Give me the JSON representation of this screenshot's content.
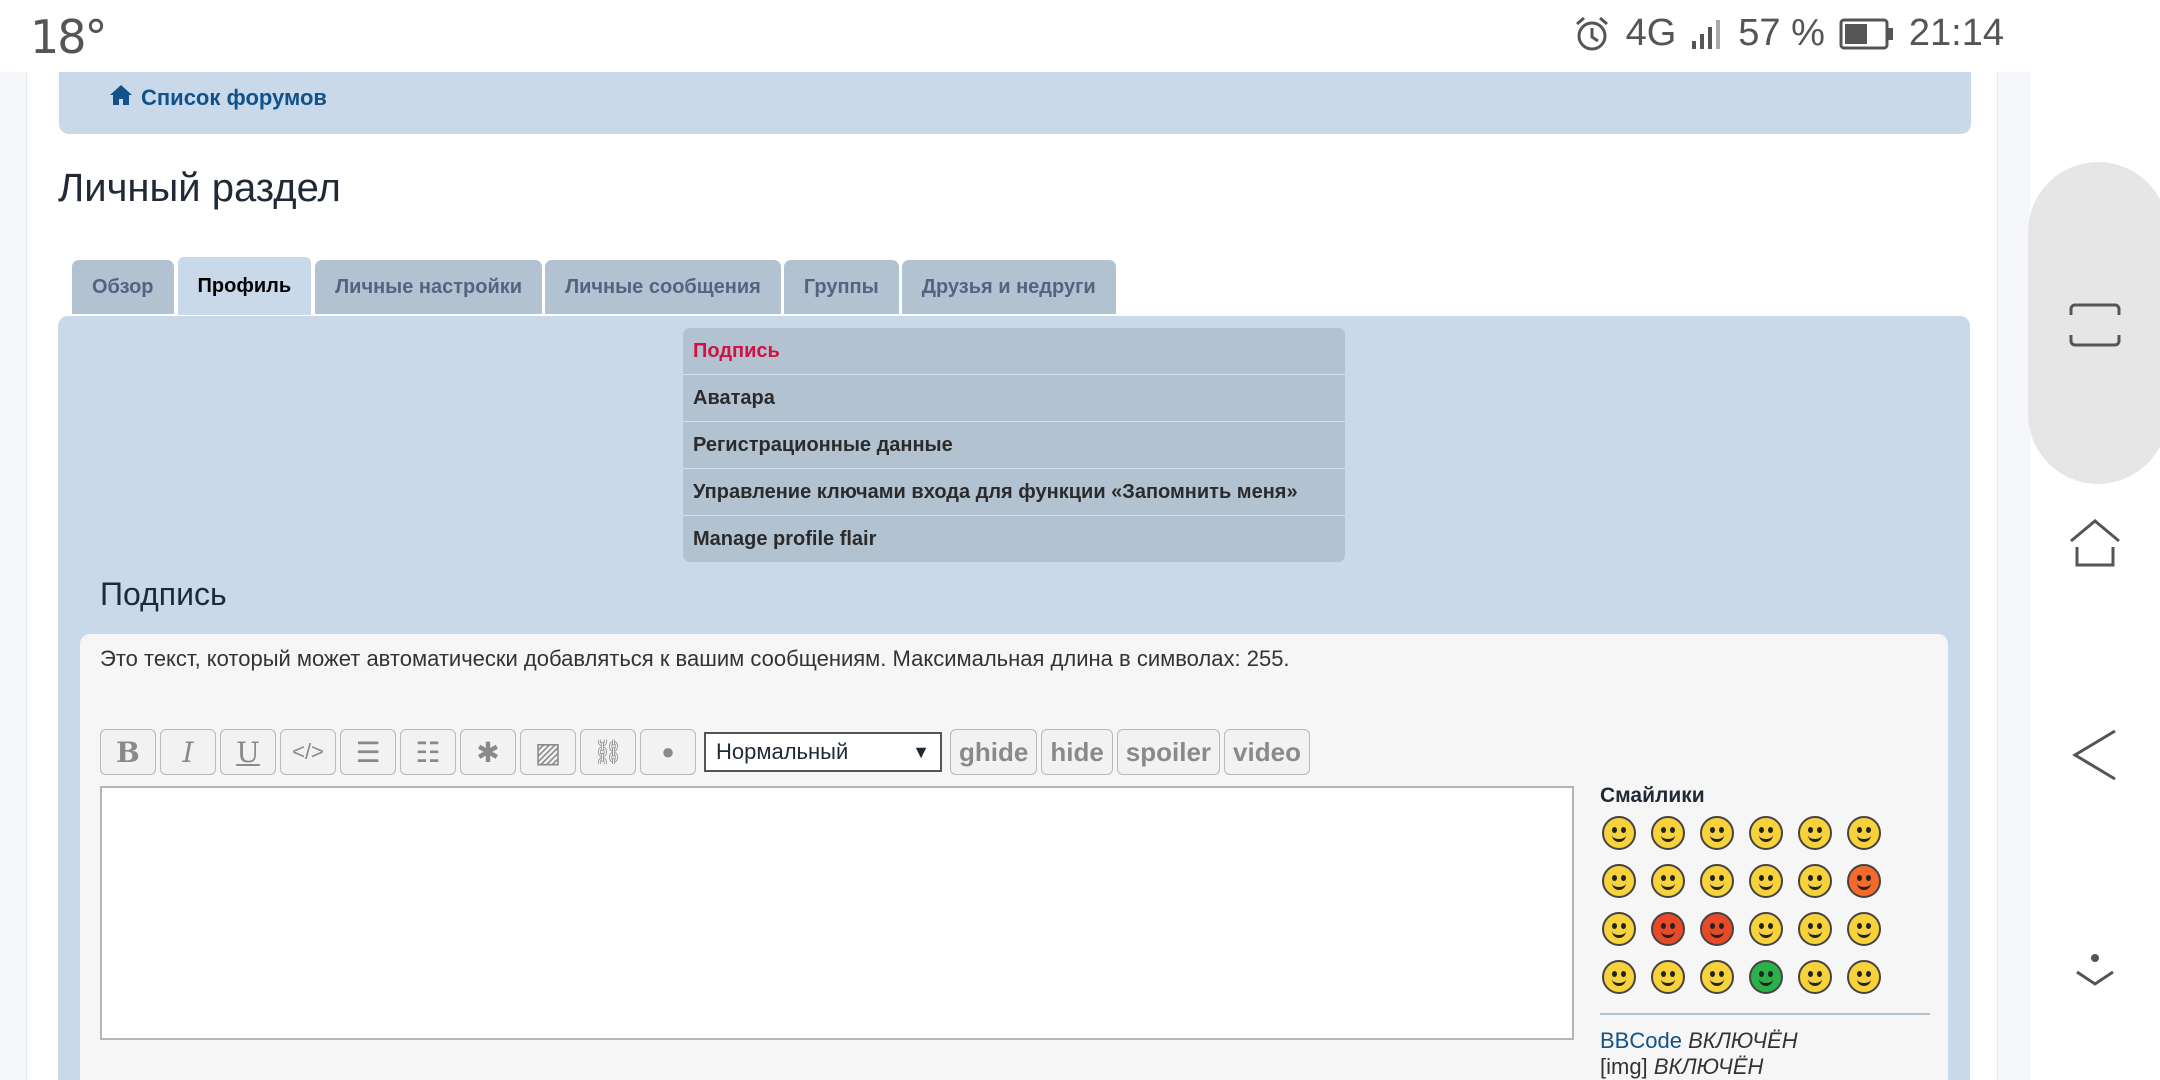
{
  "status_bar": {
    "temperature": "18°",
    "network": "4G",
    "battery": "57 %",
    "time": "21:14"
  },
  "forum_nav": {
    "link_label": "Список форумов"
  },
  "page_title": "Личный раздел",
  "tabs": [
    {
      "label": "Обзор",
      "active": false
    },
    {
      "label": "Профиль",
      "active": true
    },
    {
      "label": "Личные настройки",
      "active": false
    },
    {
      "label": "Личные сообщения",
      "active": false
    },
    {
      "label": "Группы",
      "active": false
    },
    {
      "label": "Друзья и недруги",
      "active": false
    }
  ],
  "submenu": [
    {
      "label": "Подпись",
      "active": true
    },
    {
      "label": "Аватара",
      "active": false
    },
    {
      "label": "Регистрационные данные",
      "active": false
    },
    {
      "label": "Управление ключами входа для функции «Запомнить меня»",
      "active": false
    },
    {
      "label": "Manage profile flair",
      "active": false
    }
  ],
  "section": {
    "title": "Подпись",
    "description": "Это текст, который может автоматически добавляться к вашим сообщениям. Максимальная длина в символах: 255."
  },
  "editor": {
    "icon_buttons": [
      {
        "name": "bold-button",
        "glyph": "B"
      },
      {
        "name": "italic-button",
        "glyph": "I"
      },
      {
        "name": "underline-button",
        "glyph": "U"
      },
      {
        "name": "code-button",
        "glyph": "</>"
      },
      {
        "name": "list-button",
        "glyph": "☰"
      },
      {
        "name": "numbered-list-button",
        "glyph": "☷"
      },
      {
        "name": "list-item-button",
        "glyph": "✱"
      },
      {
        "name": "image-button",
        "glyph": "▨"
      },
      {
        "name": "link-button",
        "glyph": "⛓"
      },
      {
        "name": "color-button",
        "glyph": "●"
      }
    ],
    "font_size_selected": "Нормальный",
    "word_buttons": [
      "ghide",
      "hide",
      "spoiler",
      "video"
    ],
    "textarea_value": ""
  },
  "smilies": {
    "title": "Смайлики",
    "colors": [
      "#f7d23a",
      "#f7d23a",
      "#f7d23a",
      "#f7d23a",
      "#f7d23a",
      "#f7d23a",
      "#f7d23a",
      "#f7d23a",
      "#f7d23a",
      "#f7d23a",
      "#f7d23a",
      "#f36a2a",
      "#f7d23a",
      "#e84a28",
      "#e84a28",
      "#f7d23a",
      "#f7d23a",
      "#f7d23a",
      "#f7d23a",
      "#f7d23a",
      "#f7d23a",
      "#2bb04a",
      "#f7d23a",
      "#f7d23a"
    ]
  },
  "bbcode_info": [
    {
      "label": "BBCode",
      "state": "ВКЛЮЧЁН"
    },
    {
      "label": "[img]",
      "state": "ВКЛЮЧЁН"
    }
  ]
}
